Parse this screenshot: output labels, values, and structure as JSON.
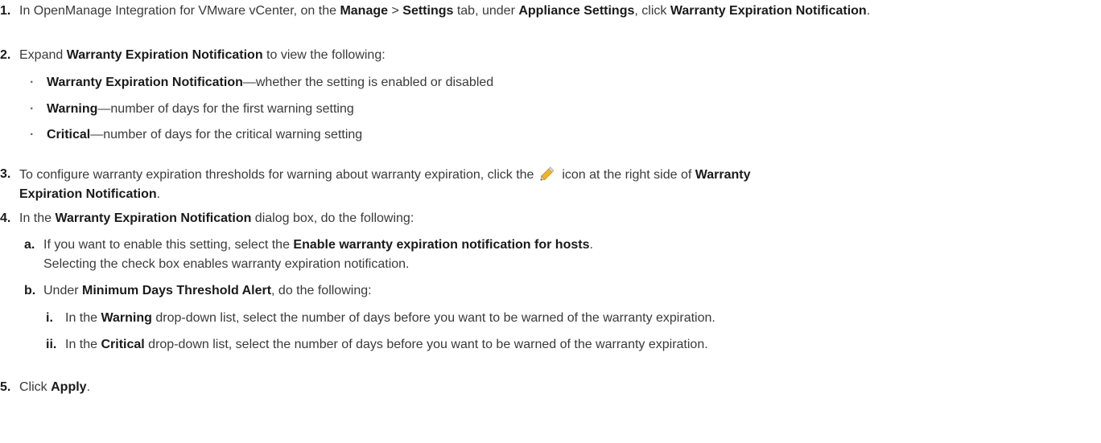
{
  "steps": [
    {
      "num": "1.",
      "parts": [
        "In OpenManage Integration for VMware vCenter, on the ",
        "Manage",
        " > ",
        "Settings",
        " tab, under ",
        "Appliance Settings",
        ", click ",
        "Warranty Expiration Notification",
        "."
      ]
    },
    {
      "num": "2.",
      "parts": [
        "Expand ",
        "Warranty Expiration Notification",
        " to view the following:"
      ],
      "bullets": [
        {
          "term": "Warranty Expiration Notification",
          "desc": "—whether the setting is enabled or disabled"
        },
        {
          "term": "Warning",
          "desc": "—number of days for the first warning setting"
        },
        {
          "term": "Critical",
          "desc": "—number of days for the critical warning setting"
        }
      ]
    },
    {
      "num": "3.",
      "parts": [
        "To configure warranty expiration thresholds for warning about warranty expiration, click the ",
        " icon at the right side of ",
        "Warranty",
        "Expiration Notification",
        "."
      ],
      "icon": "pencil-icon"
    },
    {
      "num": "4.",
      "parts": [
        "In the ",
        "Warranty Expiration Notification",
        " dialog box, do the following:"
      ],
      "substeps": [
        {
          "letter": "a.",
          "parts": [
            "If you want to enable this setting, select the ",
            "Enable warranty expiration notification for hosts",
            "."
          ],
          "line2": "Selecting the check box enables warranty expiration notification."
        },
        {
          "letter": "b.",
          "parts": [
            "Under ",
            "Minimum Days Threshold Alert",
            ", do the following:"
          ],
          "items": [
            {
              "roman": "i.",
              "parts": [
                "In the ",
                "Warning",
                " drop-down list, select the number of days before you want to be warned of the warranty expiration."
              ]
            },
            {
              "roman": "ii.",
              "parts": [
                "In the ",
                "Critical",
                " drop-down list, select the number of days before you want to be warned of the warranty expiration."
              ]
            }
          ]
        }
      ]
    },
    {
      "num": "5.",
      "parts": [
        "Click ",
        "Apply",
        "."
      ]
    }
  ],
  "colors": {
    "text": "#3a3a3a",
    "bold": "#1a1a1a",
    "pencil_body": "#f0b429",
    "pencil_tip": "#e8d6a6"
  }
}
